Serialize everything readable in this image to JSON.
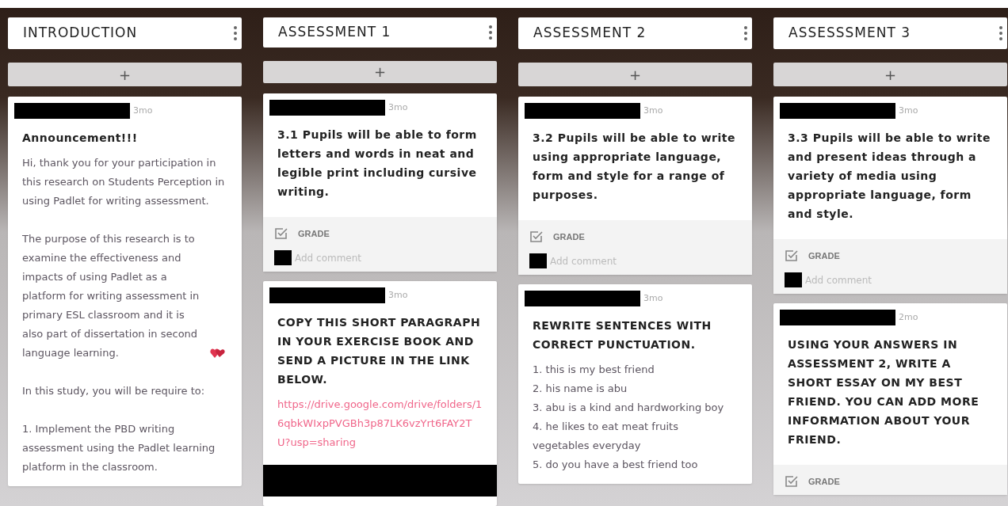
{
  "columns": [
    {
      "title": "INTRODUCTION",
      "add": "+",
      "posts": [
        {
          "time": "3mo",
          "title": "Announcement!!!",
          "blocks": [
            {
              "kind": "text",
              "text": "Hi, thank you for your participation in this research on Students Perception in using Padlet for writing assessment."
            },
            {
              "kind": "text",
              "text": "The purpose of this research is to examine the effectiveness and impacts of using Padlet as a platform for writing assessment in primary ESL classroom and it is also part of dissertation in second language learning.",
              "heart": true
            },
            {
              "kind": "text",
              "text": "In this study, you will be require to:"
            },
            {
              "kind": "text",
              "text": "1. Implement the PBD writing assessment using the Padlet learning platform in the classroom."
            }
          ]
        }
      ]
    },
    {
      "title": "ASSESSMENT 1",
      "add": "+",
      "posts": [
        {
          "time": "3mo",
          "title": "3.1 Pupils will be able to form letters and words in neat and legible print including cursive writing.",
          "footer": {
            "grade": "GRADE",
            "placeholder": "Add comment"
          }
        },
        {
          "time": "3mo",
          "title": "COPY THIS SHORT PARAGRAPH IN YOUR EXERCISE BOOK AND SEND A PICTURE IN THE LINK BELOW.",
          "blocks": [
            {
              "kind": "link",
              "text": "https://drive.google.com/drive/folders/16qbkWIxpPVGBh3p87LK6vzYrt6FAY2TU?usp=sharing"
            },
            {
              "kind": "redacted"
            }
          ]
        }
      ]
    },
    {
      "title": "ASSESSMENT 2",
      "add": "+",
      "posts": [
        {
          "time": "3mo",
          "title": "3.2 Pupils will be able to write using appropriate language, form and style for a range of purposes.",
          "footer": {
            "grade": "GRADE",
            "placeholder": "Add comment"
          }
        },
        {
          "time": "3mo",
          "title": "REWRITE SENTENCES WITH CORRECT PUNCTUATION.",
          "blocks": [
            {
              "kind": "lines",
              "lines": [
                "1. this is my best friend",
                "2. his name is abu",
                "3. abu is a kind and hardworking boy",
                "4. he likes to eat meat fruits vegetables everyday",
                "5. do you have a best friend too"
              ]
            }
          ]
        }
      ]
    },
    {
      "title": "ASSESSSMENT 3",
      "add": "+",
      "posts": [
        {
          "time": "3mo",
          "title": "3.3 Pupils will be able to write and present ideas through a variety of media using appropriate language, form and style.",
          "footer": {
            "grade": "GRADE",
            "placeholder": "Add comment"
          }
        },
        {
          "time": "2mo",
          "title": "USING YOUR ANSWERS IN ASSESSMENT 2, WRITE A SHORT ESSAY ON MY BEST FRIEND. YOU CAN ADD MORE INFORMATION ABOUT YOUR FRIEND.",
          "footer": {
            "grade": "GRADE"
          }
        }
      ]
    }
  ]
}
